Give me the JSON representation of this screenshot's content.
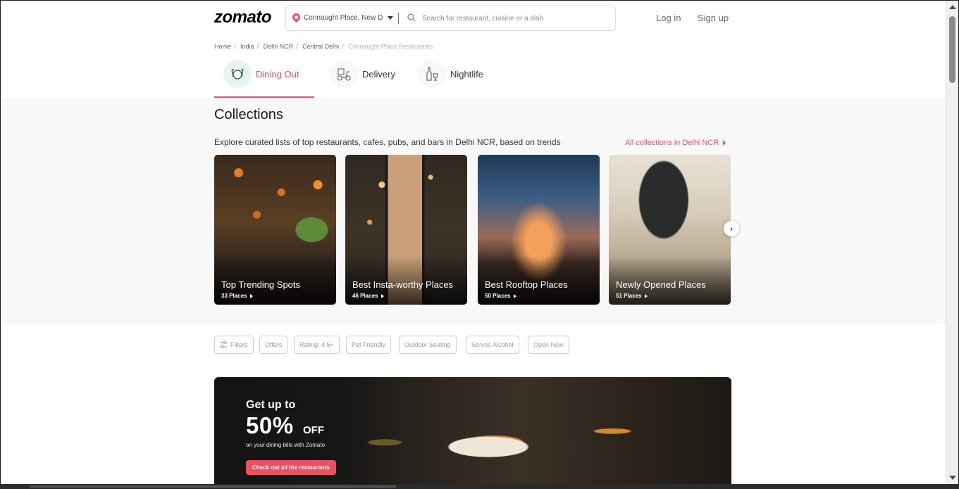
{
  "header": {
    "logo": "zomato",
    "location": "Connaught Place, New D",
    "search_placeholder": "Search for restaurant, cuisine or a dish",
    "login": "Log in",
    "signup": "Sign up"
  },
  "breadcrumb": [
    "Home",
    "India",
    "Delhi NCR",
    "Central Delhi",
    "Connaught Place Restaurants"
  ],
  "tabs": [
    {
      "label": "Dining Out",
      "icon": "dining-out-icon",
      "active": true
    },
    {
      "label": "Delivery",
      "icon": "delivery-scooter-icon",
      "active": false
    },
    {
      "label": "Nightlife",
      "icon": "nightlife-bottle-icon",
      "active": false
    }
  ],
  "collections": {
    "title": "Collections",
    "subtitle": "Explore curated lists of top restaurants, cafes, pubs, and bars in Delhi NCR, based on trends",
    "all_link": "All collections in Delhi NCR",
    "cards": [
      {
        "title": "Top Trending Spots",
        "count": "33 Places"
      },
      {
        "title": "Best Insta-worthy Places",
        "count": "46 Places"
      },
      {
        "title": "Best Rooftop Places",
        "count": "50 Places"
      },
      {
        "title": "Newly Opened Places",
        "count": "51 Places"
      }
    ]
  },
  "filters": [
    "Filters",
    "Offers",
    "Rating: 4.5+",
    "Pet Friendly",
    "Outdoor Seating",
    "Serves Alcohol",
    "Open Now"
  ],
  "banner": {
    "kicker": "Get up to",
    "percent": "50%",
    "off": "OFF",
    "description": "on your dining bills with Zomato",
    "cta": "Check out all the restaurants"
  },
  "colors": {
    "brand": "#ef4f5f",
    "text": "#1c1c1c",
    "muted": "#696969"
  }
}
